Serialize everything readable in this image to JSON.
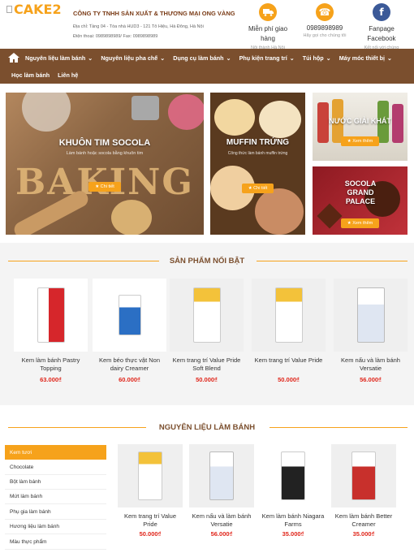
{
  "header": {
    "logo_text": "CAKE2",
    "company": "CÔNG TY TNHH SẢN XUẤT & THƯƠNG MẠI ONG VÀNG",
    "address": "Địa chỉ: Tầng 04 - Tòa nhà HUD3 - 121 Tô Hiệu, Hà Đông, Hà Nội",
    "phone_line": "Điện thoại: 0989898989/ Fax: 0989898989",
    "info": [
      {
        "icon": "truck-icon",
        "title": "Miễn phí giao hàng",
        "sub": "Nội thành Hà Nội"
      },
      {
        "icon": "phone-icon",
        "title": "0989898989",
        "sub": "Hãy gọi cho chúng tôi"
      },
      {
        "icon": "facebook-icon",
        "title": "Fanpage Facebook",
        "sub": "Kết nối với chúng tôi"
      }
    ]
  },
  "nav": {
    "row1": [
      "Nguyên liệu làm bánh",
      "Nguyên liệu pha chế",
      "Dụng cụ làm bánh",
      "Phụ kiện trang trí",
      "Túi hộp",
      "Máy móc thiết bị"
    ],
    "row2": [
      "Học làm bánh",
      "Liên hệ"
    ]
  },
  "banners": {
    "b1": {
      "title": "KHUÔN TIM SOCOLA",
      "desc": "Làm bánh hoặc socola bằng khuôn tim",
      "button": "Chi tiết",
      "word": "BAKING"
    },
    "b2": {
      "title": "MUFFIN TRỨNG",
      "desc": "Công thức làm bánh muffin trứng",
      "button": "Chi tiết"
    },
    "b3": {
      "title": "NƯỚC GIẢI KHÁT",
      "button": "Xem thêm"
    },
    "b4": {
      "title": "SOCOLA GRAND PALACE",
      "button": "Xem thêm"
    }
  },
  "featured": {
    "title": "SẢN PHẨM NỔI BẬT",
    "products": [
      {
        "name": "Kem làm bánh Pastry Topping",
        "price": "63.000₫",
        "color": "#d6262b"
      },
      {
        "name": "Kem béo thực vật Non dairy Creamer",
        "price": "60.000₫",
        "color": "#2b6fc4"
      },
      {
        "name": "Kem trang trí Value Pride Soft Blend",
        "price": "50.000₫",
        "color": "#f3c23a"
      },
      {
        "name": "Kem trang trí Value Pride",
        "price": "50.000₫",
        "color": "#2b6fc4"
      },
      {
        "name": "Kem nấu và làm bánh Versatie",
        "price": "56.000₫",
        "color": "#3a6fb3"
      }
    ]
  },
  "ingredients": {
    "title": "NGUYÊN LIỆU LÀM BÁNH",
    "categories": [
      "Kem tươi",
      "Chocolate",
      "Bột làm bánh",
      "Mứt làm bánh",
      "Phụ gia làm bánh",
      "Hương liệu làm bánh",
      "Màu thực phẩm"
    ],
    "products": [
      {
        "name": "Kem trang trí Value Pride",
        "price": "50.000₫",
        "color": "#f3c23a"
      },
      {
        "name": "Kem nấu và làm bánh Versatie",
        "price": "56.000₫",
        "color": "#3a6fb3"
      },
      {
        "name": "Kem làm bánh Niagara Farms",
        "price": "35.000₫",
        "color": "#222"
      },
      {
        "name": "Kem làm bánh Better Creamer",
        "price": "35.000₫",
        "color": "#c8302c"
      }
    ]
  }
}
